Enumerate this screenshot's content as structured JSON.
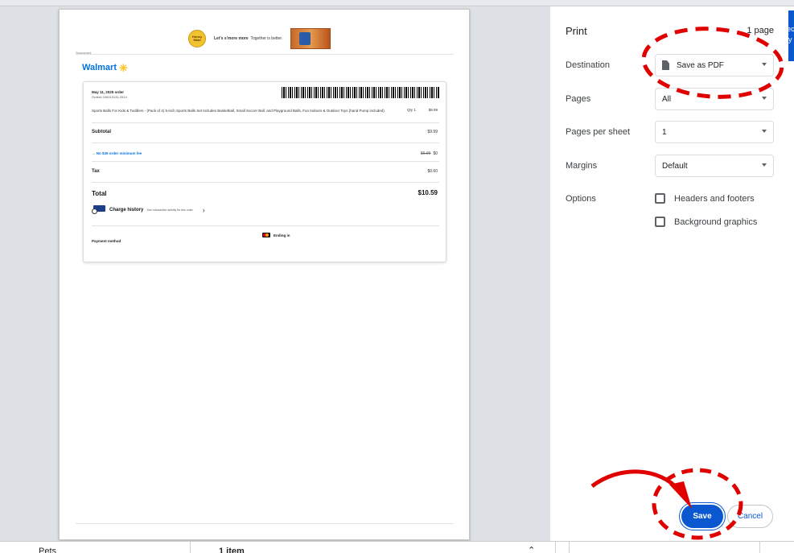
{
  "background_page": {
    "left_label": "Pets",
    "middle_label": "1 item",
    "caret": "⌃"
  },
  "preview": {
    "ad": {
      "logo_text": "Honey Maid",
      "tagline_bold": "Let's s'more more",
      "tagline": "Together is better.",
      "sponsored": "Sponsored"
    },
    "brand": "Walmart",
    "order": {
      "date": "May 11, 2025 order",
      "order_number": "Order# 200013131-2514",
      "product": "Sports Balls For Kids & Toddlers - (Pack of 4) 5-inch Sports Balls Set Includes Basketball, Small Soccer Ball, and Playground Balls, Fun Indoors & Outdoor Toys (hand Pump included)",
      "qty": "Qty 1",
      "price": "$9.99",
      "subtotal_label": "Subtotal",
      "subtotal": "$9.99",
      "fee_label": "No $35 order minimum fee",
      "fee_original": "$6.99",
      "fee_value": "$0",
      "tax_label": "Tax",
      "tax": "$0.60",
      "total_label": "Total",
      "total": "$10.59",
      "history_title": "Charge history",
      "history_sub": "Your transaction activity for this order",
      "chevron": "›",
      "payment_label": "Payment method",
      "card_text": "Ending in"
    }
  },
  "panel": {
    "title": "Print",
    "page_count": "1 page",
    "destination_label": "Destination",
    "destination_value": "Save as PDF",
    "pages_label": "Pages",
    "pages_value": "All",
    "pps_label": "Pages per sheet",
    "pps_value": "1",
    "margins_label": "Margins",
    "margins_value": "Default",
    "options_label": "Options",
    "headers_footers": "Headers and footers",
    "background_graphics": "Background graphics",
    "save_label": "Save",
    "cancel_label": "Cancel",
    "edge_text": "ec y"
  },
  "colors": {
    "accent": "#0b57d0",
    "annotation": "#e00000",
    "walmart_blue": "#0071dc",
    "walmart_yellow": "#ffc220"
  }
}
